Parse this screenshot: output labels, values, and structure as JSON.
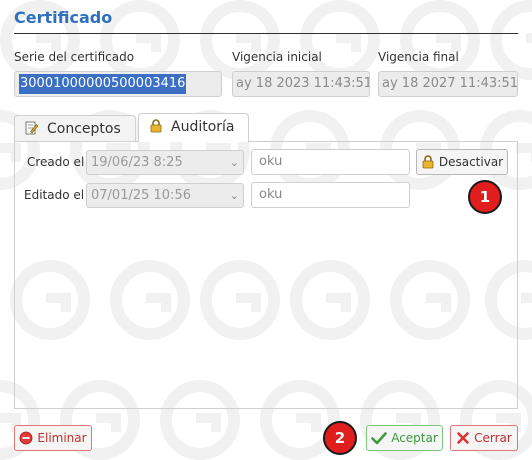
{
  "dialog": {
    "title": "Certificado"
  },
  "serie": {
    "label": "Serie del certificado",
    "value": "30001000000500003416"
  },
  "vigencia_inicial": {
    "label": "Vigencia inicial",
    "value": "ay 18 2023 11:43:51"
  },
  "vigencia_final": {
    "label": "Vigencia final",
    "value": "ay 18 2027 11:43:51"
  },
  "tabs": [
    {
      "label": "Conceptos",
      "icon": "edit-document-icon"
    },
    {
      "label": "Auditoría",
      "icon": "lock-icon"
    }
  ],
  "audit": {
    "created": {
      "label": "Creado el",
      "date": "19/06/23 8:25",
      "user": "oku"
    },
    "edited": {
      "label": "Editado el",
      "date": "07/01/25 10:56",
      "user": "oku"
    },
    "deactivate_label": "Desactivar"
  },
  "footer": {
    "delete_label": "Eliminar",
    "accept_label": "Aceptar",
    "close_label": "Cerrar"
  },
  "markers": [
    "1",
    "2"
  ],
  "colors": {
    "title": "#2f6fbf",
    "selection": "#3a6fc4",
    "marker": "#e01e1e",
    "accept": "#3a9a3a",
    "danger": "#c0302c"
  }
}
